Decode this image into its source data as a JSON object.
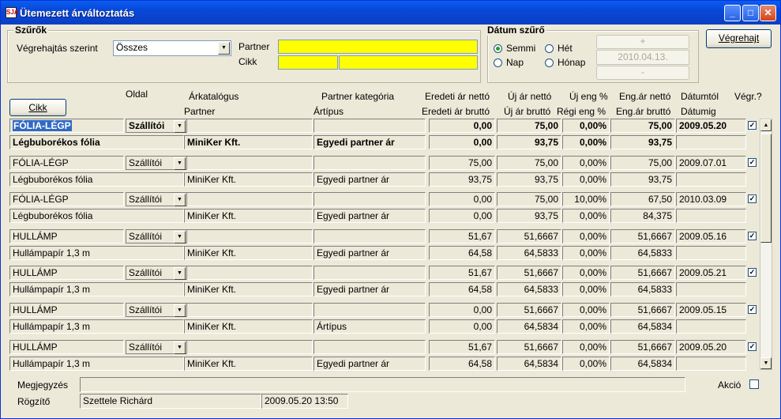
{
  "window": {
    "title": "Ütemezett árváltoztatás",
    "app_icon": "SJA"
  },
  "filters": {
    "group_title": "Szűrők",
    "exec_label": "Végrehajtás szerint",
    "exec_value": "Összes",
    "partner_label": "Partner",
    "cikk_label": "Cikk"
  },
  "date_filter": {
    "group_title": "Dátum szűrő",
    "options": {
      "semmi": "Semmi",
      "het": "Hét",
      "nap": "Nap",
      "honap": "Hónap"
    },
    "selected": "Semmi",
    "plus": "+",
    "minus": "-",
    "date": "2010.04.13."
  },
  "execute_button": "Végrehajt",
  "cikk_button": "Cikk",
  "headers": {
    "oldal": "Oldal",
    "arkatalogus": "Árkatalógus",
    "partner": "Partner",
    "partner_kategoria": "Partner kategória",
    "artipus": "Ártípus",
    "eredeti_netto": "Eredeti ár nettó",
    "eredeti_brutto": "Eredeti ár bruttó",
    "uj_netto": "Új ár nettó",
    "uj_brutto": "Új ár bruttó",
    "uj_eng": "Új eng %",
    "regi_eng": "Régi eng %",
    "eng_netto": "Eng.ár nettó",
    "eng_brutto": "Eng.ár bruttó",
    "datumtol": "Dátumtól",
    "datumig": "Dátumig",
    "vegr": "Végr.?"
  },
  "rows": [
    {
      "cikk": "FÓLIA-LÉGP",
      "oldal": "Szállítói",
      "name": "Légbuborékos fólia",
      "partner": "MiniKer Kft.",
      "artipus": "Egyedi partner ár",
      "er_n": "0,00",
      "uj_n": "75,00",
      "uj_eng": "0,00%",
      "eng_n": "75,00",
      "datum": "2009.05.20",
      "er_b": "0,00",
      "uj_b": "93,75",
      "regi_eng": "0,00%",
      "eng_b": "93,75",
      "checked": true
    },
    {
      "cikk": "FÓLIA-LÉGP",
      "oldal": "Szállítói",
      "name": "Légbuborékos fólia",
      "partner": "MiniKer Kft.",
      "artipus": "Egyedi partner ár",
      "er_n": "75,00",
      "uj_n": "75,00",
      "uj_eng": "0,00%",
      "eng_n": "75,00",
      "datum": "2009.07.01",
      "er_b": "93,75",
      "uj_b": "93,75",
      "regi_eng": "0,00%",
      "eng_b": "93,75",
      "checked": true
    },
    {
      "cikk": "FÓLIA-LÉGP",
      "oldal": "Szállítói",
      "name": "Légbuborékos fólia",
      "partner": "MiniKer Kft.",
      "artipus": "Egyedi partner ár",
      "er_n": "0,00",
      "uj_n": "75,00",
      "uj_eng": "10,00%",
      "eng_n": "67,50",
      "datum": "2010.03.09",
      "er_b": "0,00",
      "uj_b": "93,75",
      "regi_eng": "0,00%",
      "eng_b": "84,375",
      "checked": true
    },
    {
      "cikk": "HULLÁMP",
      "oldal": "Szállítói",
      "name": "Hullámpapír 1,3 m",
      "partner": "MiniKer Kft.",
      "artipus": "Egyedi partner ár",
      "er_n": "51,67",
      "uj_n": "51,6667",
      "uj_eng": "0,00%",
      "eng_n": "51,6667",
      "datum": "2009.05.16",
      "er_b": "64,58",
      "uj_b": "64,5833",
      "regi_eng": "0,00%",
      "eng_b": "64,5833",
      "checked": true
    },
    {
      "cikk": "HULLÁMP",
      "oldal": "Szállítói",
      "name": "Hullámpapír 1,3 m",
      "partner": "MiniKer Kft.",
      "artipus": "Egyedi partner ár",
      "er_n": "51,67",
      "uj_n": "51,6667",
      "uj_eng": "0,00%",
      "eng_n": "51,6667",
      "datum": "2009.05.21",
      "er_b": "64,58",
      "uj_b": "64,5833",
      "regi_eng": "0,00%",
      "eng_b": "64,5833",
      "checked": true
    },
    {
      "cikk": "HULLÁMP",
      "oldal": "Szállítói",
      "name": "Hullámpapír 1,3 m",
      "partner": "MiniKer Kft.",
      "artipus": "Ártípus",
      "er_n": "0,00",
      "uj_n": "51,6667",
      "uj_eng": "0,00%",
      "eng_n": "51,6667",
      "datum": "2009.05.15",
      "er_b": "0,00",
      "uj_b": "64,5834",
      "regi_eng": "0,00%",
      "eng_b": "64,5834",
      "checked": true
    },
    {
      "cikk": "HULLÁMP",
      "oldal": "Szállítói",
      "name": "Hullámpapír 1,3 m",
      "partner": "MiniKer Kft.",
      "artipus": "Egyedi partner ár",
      "er_n": "51,67",
      "uj_n": "51,6667",
      "uj_eng": "0,00%",
      "eng_n": "51,6667",
      "datum": "2009.05.20",
      "er_b": "64,58",
      "uj_b": "64,5834",
      "regi_eng": "0,00%",
      "eng_b": "64,5834",
      "checked": true
    }
  ],
  "footer": {
    "megjegyzes_label": "Megjegyzés",
    "megjegyzes_value": "",
    "akcio_label": "Akció",
    "rogzito_label": "Rögzítő",
    "rogzito_value": "Szettele Richárd",
    "rogzito_date": "2009.05.20 13:50"
  }
}
